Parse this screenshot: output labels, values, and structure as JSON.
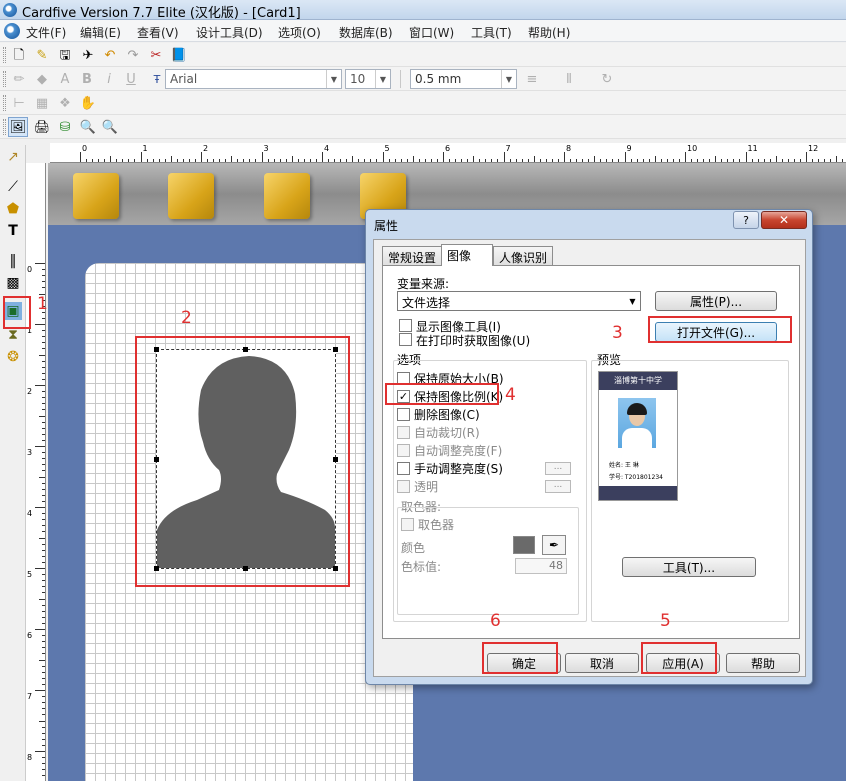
{
  "window": {
    "title": "Cardfive Version 7.7 Elite (汉化版) - [Card1]"
  },
  "menu": [
    "文件(F)",
    "编辑(E)",
    "查看(V)",
    "设计工具(D)",
    "选项(O)",
    "数据库(B)",
    "窗口(W)",
    "工具(T)",
    "帮助(H)"
  ],
  "toolbar": {
    "font_name": "Arial",
    "font_size": "10",
    "line_width": "0.5 mm"
  },
  "ruler": {
    "h_labels": [
      "0",
      "1",
      "2",
      "3",
      "4",
      "5",
      "6",
      "7",
      "8",
      "9",
      "10",
      "11",
      "12"
    ],
    "v_labels": [
      "0",
      "1",
      "2",
      "3",
      "4",
      "5",
      "6",
      "7",
      "8"
    ]
  },
  "annotations": [
    "1",
    "2",
    "3",
    "4",
    "5",
    "6"
  ],
  "dialog": {
    "title": "属性",
    "help_btn": "?",
    "close_btn": "✕",
    "tabs": [
      "常规设置",
      "图像",
      "人像识别"
    ],
    "variable_source_label": "变量来源:",
    "variable_source_value": "文件选择",
    "properties_btn": "属性(P)...",
    "open_file_btn": "打开文件(G)...",
    "show_image_tools": "显示图像工具(I)",
    "get_image_on_print": "在打印时获取图像(U)",
    "options_title": "选项",
    "opt_keep_original": "保持原始大小(B)",
    "opt_keep_ratio": "保持图像比例(K)",
    "opt_delete_image": "删除图像(C)",
    "opt_auto_crop": "自动裁切(R)",
    "opt_auto_brightness": "自动调整亮度(F)",
    "opt_manual_brightness": "手动调整亮度(S)",
    "opt_transparent": "透明",
    "ellipsis": "...",
    "picker_title": "取色器:",
    "picker_check": "取色器",
    "color_label": "颜色",
    "color_value_label": "色标值:",
    "color_value": "48",
    "preview_title": "预览",
    "preview_card_header": "淄博第十中学",
    "preview_name_label": "姓名: 王 琳",
    "preview_number": "学号: T201801234",
    "tools_btn": "工具(T)...",
    "ok_btn": "确定",
    "cancel_btn": "取消",
    "apply_btn": "应用(A)",
    "help_bottom_btn": "帮助"
  },
  "colors": {
    "canvas_bg": "#5d78ad",
    "annotation_red": "#e03030",
    "silhouette": "#606060",
    "card_header": "#3b3f5e"
  }
}
